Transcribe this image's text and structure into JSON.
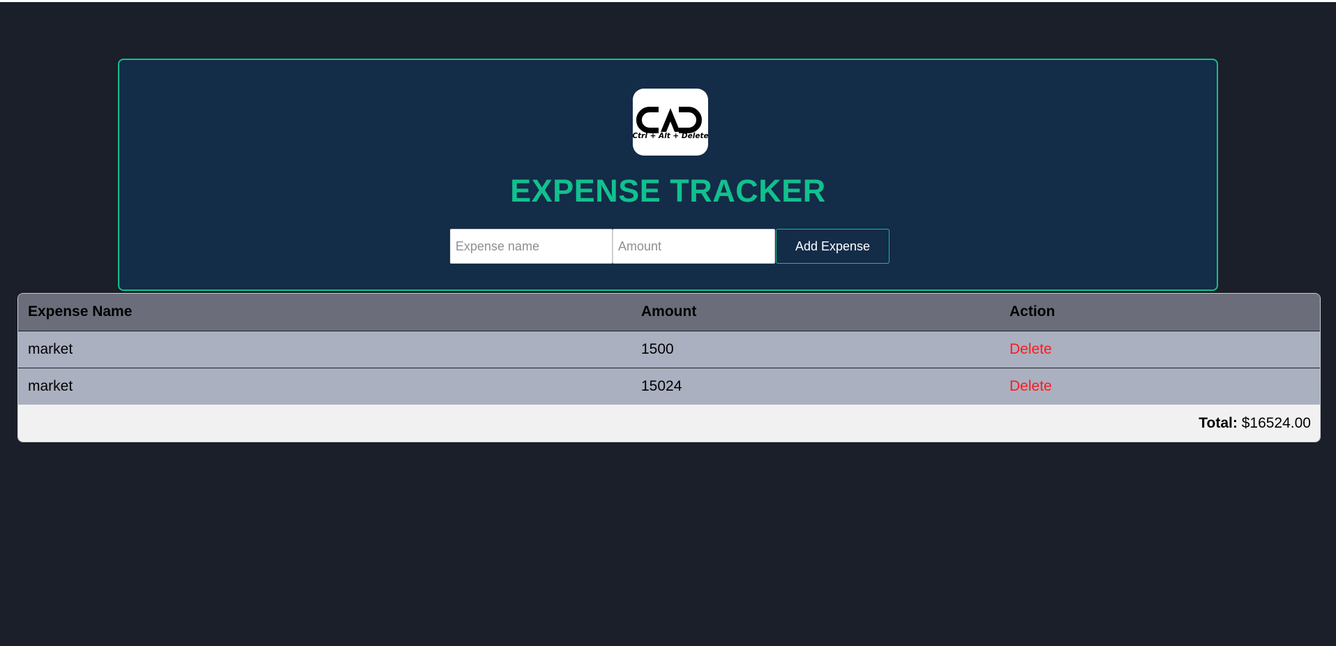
{
  "app": {
    "title": "EXPENSE TRACKER",
    "logo": {
      "icon": "cad-logo-icon",
      "text": "Ctrl + Alt + Delete"
    }
  },
  "form": {
    "name_placeholder": "Expense name",
    "name_value": "",
    "amount_placeholder": "Amount",
    "amount_value": "",
    "add_label": "Add Expense"
  },
  "table": {
    "headers": {
      "name": "Expense Name",
      "amount": "Amount",
      "action": "Action"
    },
    "rows": [
      {
        "name": "market",
        "amount": "1500",
        "action": "Delete"
      },
      {
        "name": "market",
        "amount": "15024",
        "action": "Delete"
      }
    ],
    "total_label": "Total:",
    "total_value": "$16524.00"
  },
  "colors": {
    "page_bg": "#1b1f29",
    "panel_bg": "#132c48",
    "accent": "#12c08e",
    "header_row": "#6b6e7a",
    "body_row": "#aab0c0",
    "footer_row": "#f1f1f1",
    "delete": "#ff1a1a"
  }
}
